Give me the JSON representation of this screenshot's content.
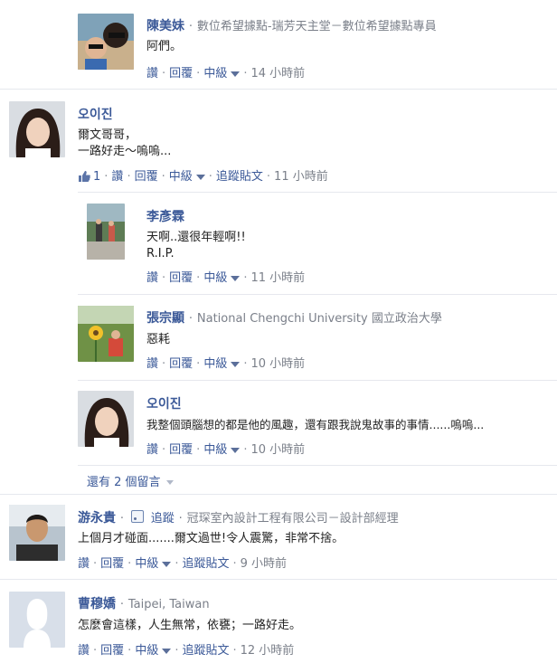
{
  "actions": {
    "like": "讚",
    "reply": "回覆",
    "level": "中級",
    "follow": "追蹤貼文",
    "dot": "·"
  },
  "comments": [
    {
      "name": "陳美妹",
      "meta": "數位希望據點-瑞芳天主堂－數位希望據點專員",
      "text1": "阿們。",
      "time": "14 小時前"
    },
    {
      "name": "오이진",
      "text1": "爾文哥哥，",
      "text2": "一路好走～嗚嗚...",
      "likes": "1",
      "time": "11 小時前"
    },
    {
      "name": "李彥霖",
      "text1": "天啊..還很年輕啊!!",
      "text2": "R.I.P.",
      "time": "11 小時前"
    },
    {
      "name": "張宗顯",
      "meta": "National Chengchi University 國立政治大學",
      "text1": "惡耗",
      "time": "10 小時前"
    },
    {
      "name": "오이진",
      "text1": "我整個頭腦想的都是他的風趣，還有跟我說鬼故事的事情......嗚嗚...",
      "time": "10 小時前"
    },
    {
      "name": "游永貴",
      "follow_label": "追蹤",
      "meta": "冠琛室內設計工程有限公司－設計部經理",
      "text1": "上個月才碰面.......爾文過世!令人震驚，非常不捨。",
      "time": "9 小時前"
    },
    {
      "name": "曹穆嬌",
      "meta": "Taipei, Taiwan",
      "text1": "怎麼會這樣，人生無常，依甕；一路好走。",
      "time": "12 小時前"
    }
  ],
  "more_comments": "還有 2 個留言"
}
